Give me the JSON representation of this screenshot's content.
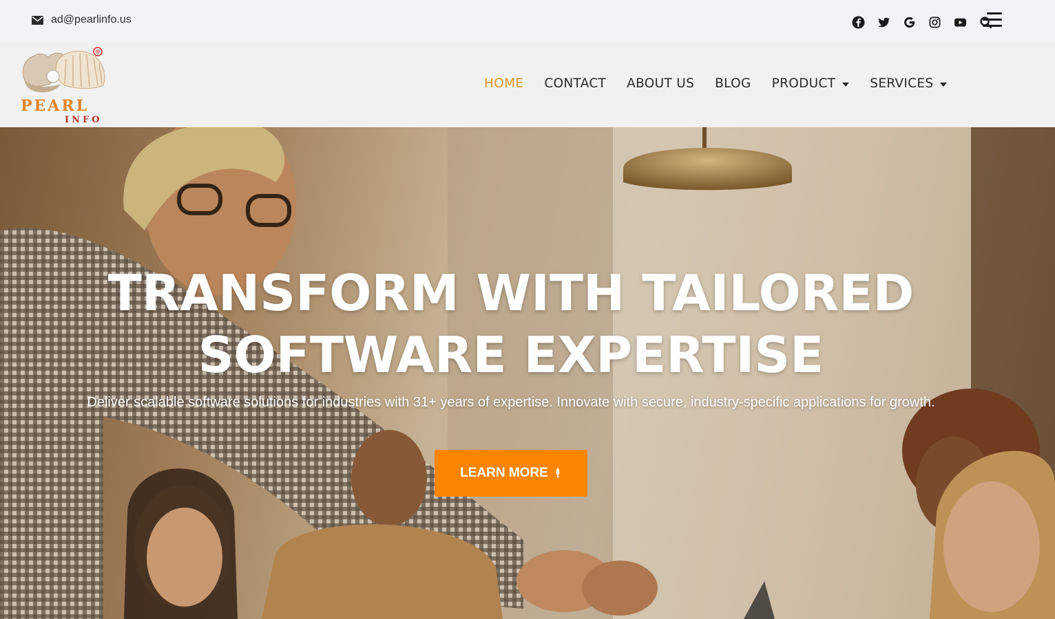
{
  "topbar": {
    "email": "ad@pearlinfo.us",
    "social_icons": [
      "facebook-icon",
      "twitter-icon",
      "google-icon",
      "instagram-icon",
      "youtube-icon",
      "search-icon"
    ],
    "menu_icon": "hamburger-menu-icon"
  },
  "header": {
    "logo": {
      "name": "PEARL",
      "sub": "INFO",
      "registered": "®"
    },
    "nav": [
      {
        "label": "HOME",
        "active": true
      },
      {
        "label": "CONTACT"
      },
      {
        "label": "ABOUT US"
      },
      {
        "label": "BLOG"
      },
      {
        "label": "PRODUCT",
        "dropdown": true
      },
      {
        "label": "SERVICES",
        "dropdown": true
      }
    ]
  },
  "hero": {
    "title_line1": "TRANSFORM WITH TAILORED",
    "title_line2": "SOFTWARE EXPERTISE",
    "subtitle": "Deliver scalable software solutions for industries with 31+ years of expertise. Innovate with secure, industry-specific applications for growth.",
    "cta_label": "LEARN MORE"
  },
  "colors": {
    "accent": "#e0952e",
    "cta": "#fb8500",
    "topbar_bg": "#f1f3f6",
    "header_bg": "#f1f1f1"
  }
}
